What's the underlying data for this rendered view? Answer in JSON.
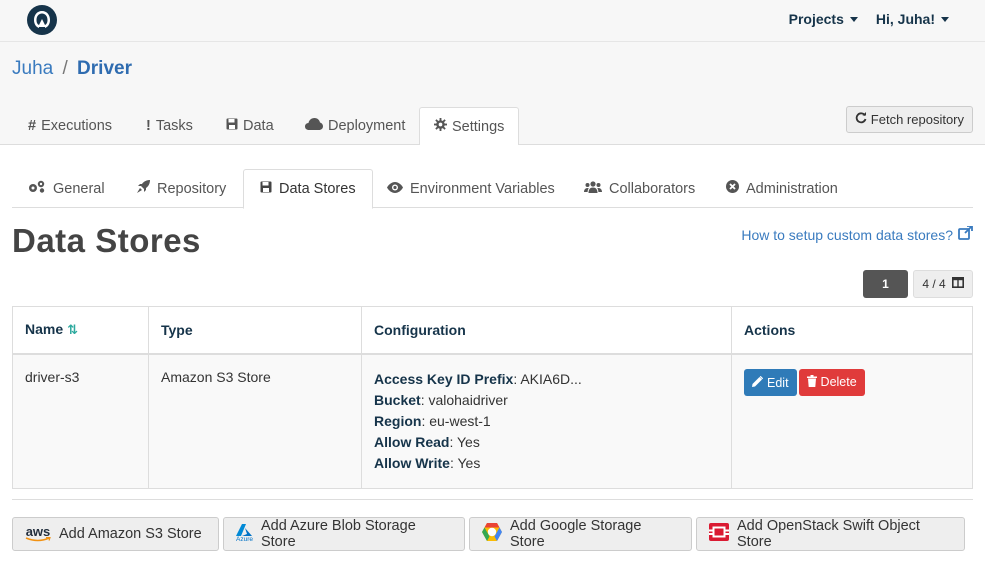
{
  "navbar": {
    "projects_label": "Projects",
    "user_label": "Hi, Juha!"
  },
  "breadcrumb": {
    "owner": "Juha",
    "separator": "/",
    "project": "Driver"
  },
  "project_tabs": [
    {
      "label": "Executions",
      "icon": "hash-icon"
    },
    {
      "label": "Tasks",
      "icon": "exclamation-icon"
    },
    {
      "label": "Data",
      "icon": "floppy-icon"
    },
    {
      "label": "Deployment",
      "icon": "cloud-icon"
    },
    {
      "label": "Settings",
      "icon": "gear-icon",
      "active": true
    }
  ],
  "fetch_button": "Fetch repository",
  "settings_tabs": [
    {
      "label": "General",
      "icon": "gears-icon"
    },
    {
      "label": "Repository",
      "icon": "rocket-icon"
    },
    {
      "label": "Data Stores",
      "icon": "floppy-icon",
      "active": true
    },
    {
      "label": "Environment Variables",
      "icon": "eye-icon"
    },
    {
      "label": "Collaborators",
      "icon": "users-icon"
    },
    {
      "label": "Administration",
      "icon": "close-circle-icon"
    }
  ],
  "page": {
    "title": "Data Stores",
    "help_link": "How to setup custom data stores?"
  },
  "pager": {
    "page": "1",
    "columns": "4 / 4"
  },
  "table": {
    "headers": [
      "Name",
      "Type",
      "Configuration",
      "Actions"
    ],
    "rows": [
      {
        "name": "driver-s3",
        "type": "Amazon S3 Store",
        "config": [
          {
            "key": "Access Key ID Prefix",
            "value": ": AKIA6D..."
          },
          {
            "key": "Bucket",
            "value": ": valohaidriver"
          },
          {
            "key": "Region",
            "value": ": eu-west-1"
          },
          {
            "key": "Allow Read",
            "value": ": Yes"
          },
          {
            "key": "Allow Write",
            "value": ": Yes"
          }
        ],
        "edit_label": "Edit",
        "delete_label": "Delete"
      }
    ]
  },
  "add_buttons": [
    {
      "label": "Add Amazon S3 Store",
      "icon": "aws-icon",
      "icon_text": "aws"
    },
    {
      "label": "Add Azure Blob Storage Store",
      "icon": "azure-icon",
      "icon_text": "Azure"
    },
    {
      "label": "Add Google Storage Store",
      "icon": "google-cloud-icon"
    },
    {
      "label": "Add OpenStack Swift Object Store",
      "icon": "openstack-icon"
    }
  ],
  "colors": {
    "brand_dark": "#16344a",
    "link": "#3a7bbf",
    "edit": "#2f7bb8",
    "delete": "#e03b3b",
    "sort_icon": "#2eaa9f"
  }
}
